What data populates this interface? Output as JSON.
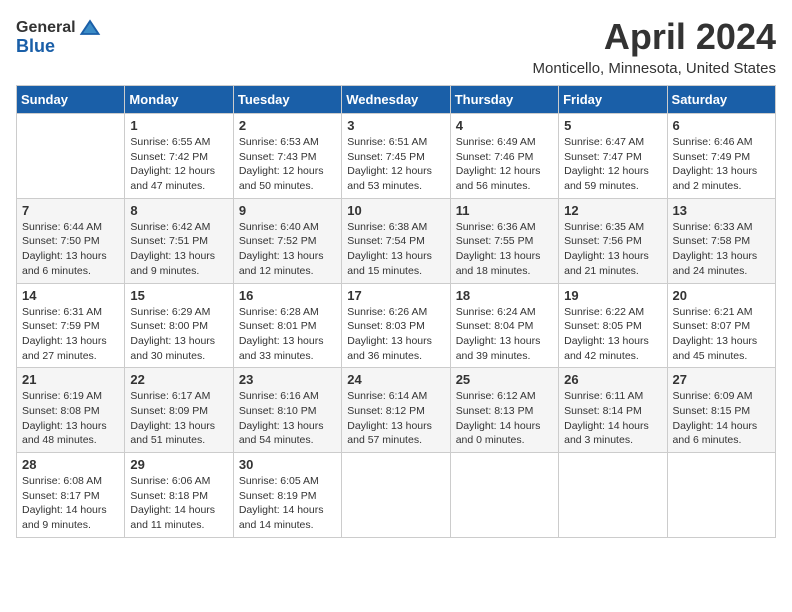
{
  "header": {
    "logo_general": "General",
    "logo_blue": "Blue",
    "title": "April 2024",
    "location": "Monticello, Minnesota, United States"
  },
  "weekdays": [
    "Sunday",
    "Monday",
    "Tuesday",
    "Wednesday",
    "Thursday",
    "Friday",
    "Saturday"
  ],
  "weeks": [
    [
      {
        "day": "",
        "info": ""
      },
      {
        "day": "1",
        "info": "Sunrise: 6:55 AM\nSunset: 7:42 PM\nDaylight: 12 hours\nand 47 minutes."
      },
      {
        "day": "2",
        "info": "Sunrise: 6:53 AM\nSunset: 7:43 PM\nDaylight: 12 hours\nand 50 minutes."
      },
      {
        "day": "3",
        "info": "Sunrise: 6:51 AM\nSunset: 7:45 PM\nDaylight: 12 hours\nand 53 minutes."
      },
      {
        "day": "4",
        "info": "Sunrise: 6:49 AM\nSunset: 7:46 PM\nDaylight: 12 hours\nand 56 minutes."
      },
      {
        "day": "5",
        "info": "Sunrise: 6:47 AM\nSunset: 7:47 PM\nDaylight: 12 hours\nand 59 minutes."
      },
      {
        "day": "6",
        "info": "Sunrise: 6:46 AM\nSunset: 7:49 PM\nDaylight: 13 hours\nand 2 minutes."
      }
    ],
    [
      {
        "day": "7",
        "info": "Sunrise: 6:44 AM\nSunset: 7:50 PM\nDaylight: 13 hours\nand 6 minutes."
      },
      {
        "day": "8",
        "info": "Sunrise: 6:42 AM\nSunset: 7:51 PM\nDaylight: 13 hours\nand 9 minutes."
      },
      {
        "day": "9",
        "info": "Sunrise: 6:40 AM\nSunset: 7:52 PM\nDaylight: 13 hours\nand 12 minutes."
      },
      {
        "day": "10",
        "info": "Sunrise: 6:38 AM\nSunset: 7:54 PM\nDaylight: 13 hours\nand 15 minutes."
      },
      {
        "day": "11",
        "info": "Sunrise: 6:36 AM\nSunset: 7:55 PM\nDaylight: 13 hours\nand 18 minutes."
      },
      {
        "day": "12",
        "info": "Sunrise: 6:35 AM\nSunset: 7:56 PM\nDaylight: 13 hours\nand 21 minutes."
      },
      {
        "day": "13",
        "info": "Sunrise: 6:33 AM\nSunset: 7:58 PM\nDaylight: 13 hours\nand 24 minutes."
      }
    ],
    [
      {
        "day": "14",
        "info": "Sunrise: 6:31 AM\nSunset: 7:59 PM\nDaylight: 13 hours\nand 27 minutes."
      },
      {
        "day": "15",
        "info": "Sunrise: 6:29 AM\nSunset: 8:00 PM\nDaylight: 13 hours\nand 30 minutes."
      },
      {
        "day": "16",
        "info": "Sunrise: 6:28 AM\nSunset: 8:01 PM\nDaylight: 13 hours\nand 33 minutes."
      },
      {
        "day": "17",
        "info": "Sunrise: 6:26 AM\nSunset: 8:03 PM\nDaylight: 13 hours\nand 36 minutes."
      },
      {
        "day": "18",
        "info": "Sunrise: 6:24 AM\nSunset: 8:04 PM\nDaylight: 13 hours\nand 39 minutes."
      },
      {
        "day": "19",
        "info": "Sunrise: 6:22 AM\nSunset: 8:05 PM\nDaylight: 13 hours\nand 42 minutes."
      },
      {
        "day": "20",
        "info": "Sunrise: 6:21 AM\nSunset: 8:07 PM\nDaylight: 13 hours\nand 45 minutes."
      }
    ],
    [
      {
        "day": "21",
        "info": "Sunrise: 6:19 AM\nSunset: 8:08 PM\nDaylight: 13 hours\nand 48 minutes."
      },
      {
        "day": "22",
        "info": "Sunrise: 6:17 AM\nSunset: 8:09 PM\nDaylight: 13 hours\nand 51 minutes."
      },
      {
        "day": "23",
        "info": "Sunrise: 6:16 AM\nSunset: 8:10 PM\nDaylight: 13 hours\nand 54 minutes."
      },
      {
        "day": "24",
        "info": "Sunrise: 6:14 AM\nSunset: 8:12 PM\nDaylight: 13 hours\nand 57 minutes."
      },
      {
        "day": "25",
        "info": "Sunrise: 6:12 AM\nSunset: 8:13 PM\nDaylight: 14 hours\nand 0 minutes."
      },
      {
        "day": "26",
        "info": "Sunrise: 6:11 AM\nSunset: 8:14 PM\nDaylight: 14 hours\nand 3 minutes."
      },
      {
        "day": "27",
        "info": "Sunrise: 6:09 AM\nSunset: 8:15 PM\nDaylight: 14 hours\nand 6 minutes."
      }
    ],
    [
      {
        "day": "28",
        "info": "Sunrise: 6:08 AM\nSunset: 8:17 PM\nDaylight: 14 hours\nand 9 minutes."
      },
      {
        "day": "29",
        "info": "Sunrise: 6:06 AM\nSunset: 8:18 PM\nDaylight: 14 hours\nand 11 minutes."
      },
      {
        "day": "30",
        "info": "Sunrise: 6:05 AM\nSunset: 8:19 PM\nDaylight: 14 hours\nand 14 minutes."
      },
      {
        "day": "",
        "info": ""
      },
      {
        "day": "",
        "info": ""
      },
      {
        "day": "",
        "info": ""
      },
      {
        "day": "",
        "info": ""
      }
    ]
  ]
}
